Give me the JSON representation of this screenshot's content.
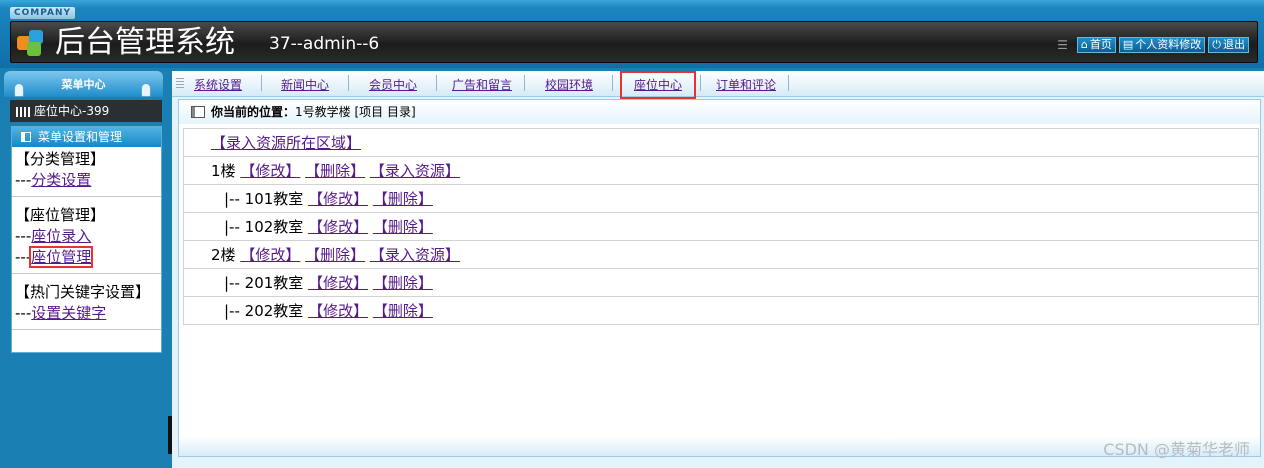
{
  "header": {
    "company": "COMPANY",
    "title": "后台管理系统",
    "user_info": "37--admin--6",
    "links": [
      {
        "label": "首页",
        "icon": "home-icon"
      },
      {
        "label": "个人资料修改",
        "icon": "profile-icon"
      },
      {
        "label": "退出",
        "icon": "power-icon"
      }
    ]
  },
  "sidebar": {
    "menu_title": "菜单中心",
    "module": "座位中心-399",
    "panel_title": "菜单设置和管理",
    "groups": [
      {
        "title": "【分类管理】",
        "items": [
          {
            "prefix": "---",
            "label": "分类设置"
          }
        ]
      },
      {
        "title": "【座位管理】",
        "items": [
          {
            "prefix": "---",
            "label": "座位录入"
          },
          {
            "prefix": "---",
            "label": "座位管理"
          }
        ]
      },
      {
        "title": "【热门关键字设置】",
        "items": [
          {
            "prefix": "---",
            "label": "设置关键字"
          }
        ]
      }
    ]
  },
  "nav": {
    "tabs": [
      "系统设置",
      "新闻中心",
      "会员中心",
      "广告和留言",
      "校园环境",
      "座位中心",
      "订单和评论"
    ],
    "active": "座位中心"
  },
  "breadcrumb": {
    "label": "你当前的位置：",
    "value": "1号教学楼 [项目 目录]"
  },
  "tree": {
    "add_area": "【录入资源所在区域】",
    "edit": "【修改】",
    "delete": "【删除】",
    "add_resource": "【录入资源】",
    "floors": [
      {
        "name": "1楼",
        "rooms": [
          "|-- 101教室",
          "|-- 102教室"
        ]
      },
      {
        "name": "2楼",
        "rooms": [
          "|-- 201教室",
          "|-- 202教室"
        ]
      }
    ]
  },
  "watermark": "CSDN @黄菊华老师",
  "colors": {
    "accent": "#1a7fb3",
    "link": "#551a8b",
    "highlight": "#e53333"
  }
}
